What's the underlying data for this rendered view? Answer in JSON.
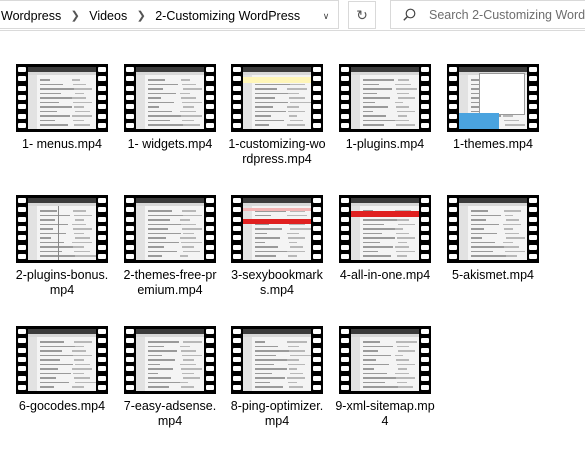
{
  "address": {
    "breadcrumbs": [
      "Wordpress",
      "Videos",
      "2-Customizing WordPress"
    ],
    "dropdown_icon": "chevron-down-icon",
    "refresh_icon": "refresh-icon"
  },
  "search": {
    "placeholder": "Search 2-Customizing WordPress",
    "icon": "search-icon"
  },
  "files": [
    {
      "name": "1- menus.mp4",
      "style": "plain"
    },
    {
      "name": "1- widgets.mp4",
      "style": "plain"
    },
    {
      "name": "1-customizing-wordpress.mp4",
      "style": "yellow"
    },
    {
      "name": "1-plugins.mp4",
      "style": "plain"
    },
    {
      "name": "1-themes.mp4",
      "style": "blue"
    },
    {
      "name": "2-plugins-bonus.mp4",
      "style": "list"
    },
    {
      "name": "2-themes-free-premium.mp4",
      "style": "plain"
    },
    {
      "name": "3-sexybookmarks.mp4",
      "style": "red"
    },
    {
      "name": "4-all-in-one.mp4",
      "style": "redbar"
    },
    {
      "name": "5-akismet.mp4",
      "style": "plain"
    },
    {
      "name": "6-gocodes.mp4",
      "style": "plain"
    },
    {
      "name": "7-easy-adsense.mp4",
      "style": "plain"
    },
    {
      "name": "8-ping-optimizer.mp4",
      "style": "plain"
    },
    {
      "name": "9-xml-sitemap.mp4",
      "style": "plain"
    }
  ],
  "colors": {
    "accent_red": "#e02020",
    "accent_blue": "#4aa3df",
    "accent_yellow": "#fff6b8"
  }
}
